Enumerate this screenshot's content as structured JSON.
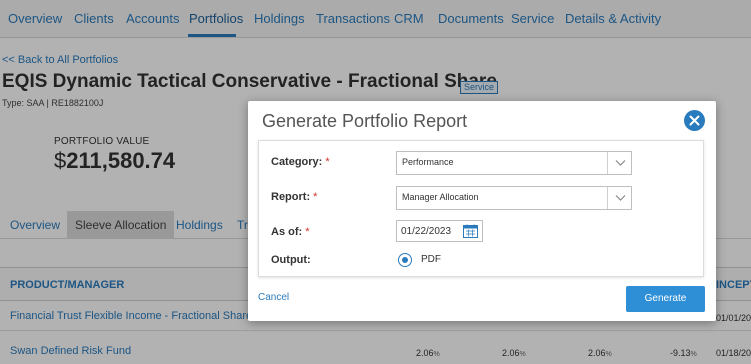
{
  "nav": {
    "items": [
      "Overview",
      "Clients",
      "Accounts",
      "Portfolios",
      "Holdings",
      "Transactions",
      "CRM",
      "Documents",
      "Service",
      "Details & Activity"
    ],
    "active": "Portfolios"
  },
  "header": {
    "back_link": "<< Back to All Portfolios",
    "title": "EQIS Dynamic Tactical Conservative - Fractional Share",
    "badge": "Service",
    "type_line": "Type: SAA | RE1882100J"
  },
  "portfolio_value": {
    "label": "PORTFOLIO VALUE",
    "currency": "$",
    "amount": "211,580.74"
  },
  "subtabs": {
    "items": [
      "Overview",
      "Sleeve Allocation",
      "Holdings",
      "Tr"
    ],
    "active": "Sleeve Allocation"
  },
  "grid": {
    "header_product": "PRODUCT/MANAGER",
    "header_inception": "INCEPT",
    "rows": [
      {
        "name": "Financial Trust Flexible Income - Fractional Share",
        "v1": "",
        "v2": "",
        "v3": "",
        "v4": "",
        "date": "01/01/20"
      },
      {
        "name": "Swan Defined Risk Fund",
        "v1": "2.06",
        "v2": "2.06",
        "v3": "2.06",
        "v4": "-9.13",
        "date": "01/18/20"
      }
    ],
    "pct_symbol": "%"
  },
  "modal": {
    "title": "Generate Portfolio Report",
    "fields": {
      "category_label": "Category:",
      "category_value": "Performance",
      "report_label": "Report:",
      "report_value": "Manager Allocation",
      "asof_label": "As of:",
      "asof_value": "01/22/2023",
      "output_label": "Output:",
      "output_value": "PDF"
    },
    "required_mark": "*",
    "cancel_label": "Cancel",
    "generate_label": "Generate"
  },
  "colors": {
    "accent": "#2a7bbd",
    "button": "#2e8fd6",
    "required": "#d0312d"
  },
  "icons": {
    "close": "close-icon",
    "chevron": "chevron-down-icon",
    "calendar": "calendar-icon",
    "radio": "radio-selected-icon"
  }
}
